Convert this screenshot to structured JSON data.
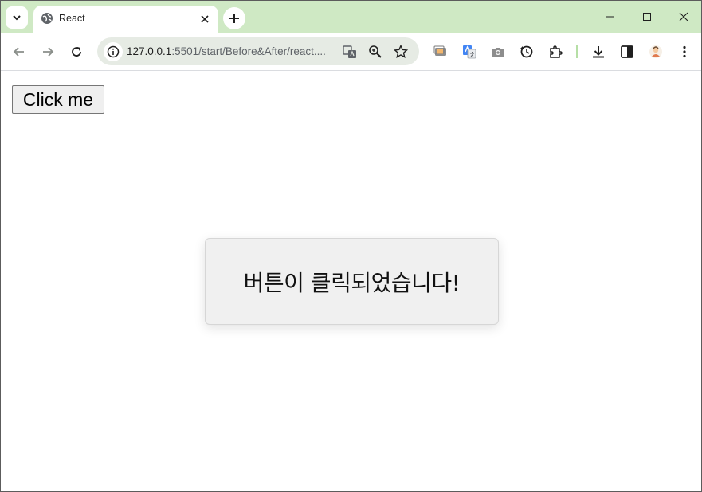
{
  "browser": {
    "tab": {
      "title": "React"
    },
    "address": {
      "host": "127.0.0.1",
      "rest": ":5501/start/Before&After/react...."
    },
    "icons": {
      "tab_search": "chevron-down-icon",
      "favicon": "globe-icon",
      "tab_close": "close-icon",
      "new_tab": "plus-icon",
      "minimize": "minimize-icon",
      "maximize": "maximize-icon",
      "close_window": "close-icon",
      "back": "back-arrow-icon",
      "forward": "forward-arrow-icon",
      "reload": "reload-icon",
      "site_info": "info-icon",
      "translate": "translate-icon",
      "zoom": "zoom-icon",
      "bookmark": "star-icon"
    }
  },
  "page": {
    "button_label": "Click me",
    "modal_message": "버튼이 클릭되었습니다!"
  },
  "colors": {
    "tabstrip": "#cfe9c4",
    "omnibox": "#e6ebe4",
    "modal_bg": "#f0f0f0",
    "button_bg": "#efefef"
  }
}
